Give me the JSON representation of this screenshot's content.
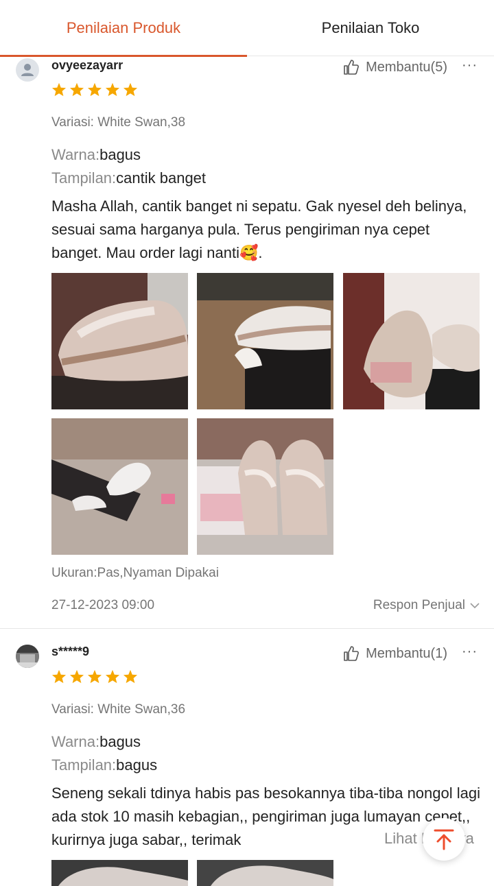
{
  "tabs": [
    {
      "label": "Penilaian Produk",
      "active": true
    },
    {
      "label": "Penilaian Toko",
      "active": false
    }
  ],
  "reviews": [
    {
      "username": "ovyeezayarr",
      "helpful_label": "Membantu(5)",
      "more_label": "···",
      "rating": 5,
      "variation": "Variasi: White Swan,38",
      "attrs": [
        {
          "key": "Warna:",
          "value": "bagus"
        },
        {
          "key": "Tampilan:",
          "value": "cantik banget"
        }
      ],
      "text": "Masha Allah, cantik banget ni sepatu. Gak nyesel deh belinya, sesuai sama harganya pula. Terus pengiriman nya cepet banget. Mau order lagi nanti🥰.",
      "photos": 5,
      "size_note": "Ukuran:Pas,Nyaman Dipakai",
      "date": "27-12-2023 09:00",
      "seller_response_label": "Respon Penjual"
    },
    {
      "username": "s*****9",
      "helpful_label": "Membantu(1)",
      "more_label": "···",
      "rating": 5,
      "variation": "Variasi: White Swan,36",
      "attrs": [
        {
          "key": "Warna:",
          "value": "bagus"
        },
        {
          "key": "Tampilan:",
          "value": "bagus"
        }
      ],
      "text": "Seneng sekali tdinya habis pas besokannya tiba-tiba nongol lagi ada stok 10 masih kebagian,, pengiriman juga lumayan cepet,, kurirnya juga sabar,, terimak",
      "see_more_label": "Lihat Lainnya"
    }
  ],
  "colors": {
    "accent": "#d9572c",
    "star": "#f6a700",
    "muted": "#757575"
  },
  "icons": {
    "thumb_up": "thumbs-up-icon",
    "chevron": "chevron-down-icon",
    "scroll_top": "arrow-up-to-top-icon"
  }
}
